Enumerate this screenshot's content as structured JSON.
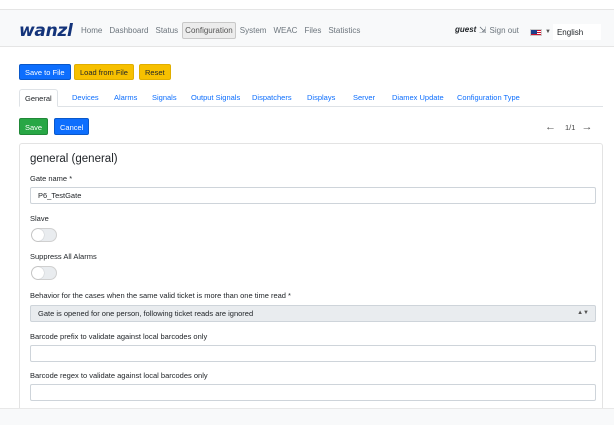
{
  "header": {
    "logo": "wanzl",
    "nav": [
      "Home",
      "Dashboard",
      "Status",
      "Configuration",
      "System",
      "WEAC",
      "Files",
      "Statistics"
    ],
    "user": "guest",
    "sign_out": "Sign out",
    "language": "English"
  },
  "toolbar": {
    "save_to_file": "Save to File",
    "load_from_file": "Load from File",
    "reset": "Reset"
  },
  "tabs": [
    "General",
    "Devices",
    "Alarms",
    "Signals",
    "Output Signals",
    "Dispatchers",
    "Displays",
    "Server",
    "Diamex Update",
    "Configuration Type"
  ],
  "actions": {
    "save": "Save",
    "cancel": "Cancel",
    "pager": "1/1"
  },
  "form": {
    "title": "general (general)",
    "gate_name_label": "Gate name *",
    "gate_name_value": "P6_TestGate",
    "slave_label": "Slave",
    "suppress_label": "Suppress All Alarms",
    "behavior_label": "Behavior for the cases when the same valid ticket is more than one time read *",
    "behavior_value": "Gate is opened for one person, following ticket reads are ignored",
    "barcode_prefix_label": "Barcode prefix to validate against local barcodes only",
    "barcode_regex_label": "Barcode regex to validate against local barcodes only"
  },
  "colors": {
    "primary": "#0d6efd",
    "warning": "#f7c000",
    "success": "#28a745",
    "logo": "#13337a"
  }
}
